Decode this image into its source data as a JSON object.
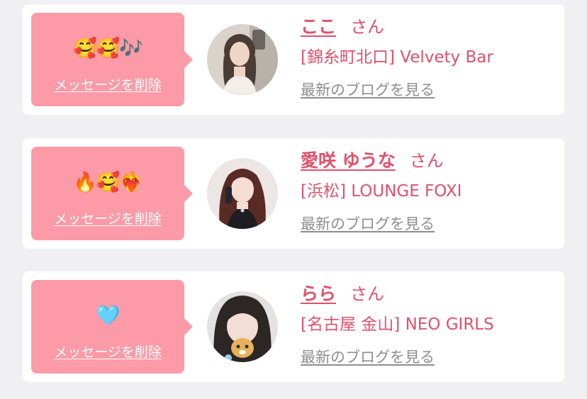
{
  "cards": [
    {
      "message": "🥰🥰🎶",
      "delete_label": "メッセージを削除",
      "name": "ここ",
      "honorific": "さん",
      "shop": "[錦糸町北口] Velvety Bar",
      "blog_label": "最新のブログを見る"
    },
    {
      "message": "🔥🥰❤️‍🔥",
      "delete_label": "メッセージを削除",
      "name": "愛咲 ゆうな",
      "honorific": "さん",
      "shop": "[浜松] LOUNGE FOXI",
      "blog_label": "最新のブログを見る"
    },
    {
      "message": "🩵",
      "delete_label": "メッセージを削除",
      "name": "らら",
      "honorific": "さん",
      "shop": "[名古屋 金山] NEO GIRLS",
      "blog_label": "最新のブログを見る"
    }
  ],
  "colors": {
    "page_background": "#f0f0f2",
    "card_background": "#ffffff",
    "bubble": "#fc9aa7",
    "accent": "#e2506b",
    "link_gray": "#8e8e8e"
  }
}
